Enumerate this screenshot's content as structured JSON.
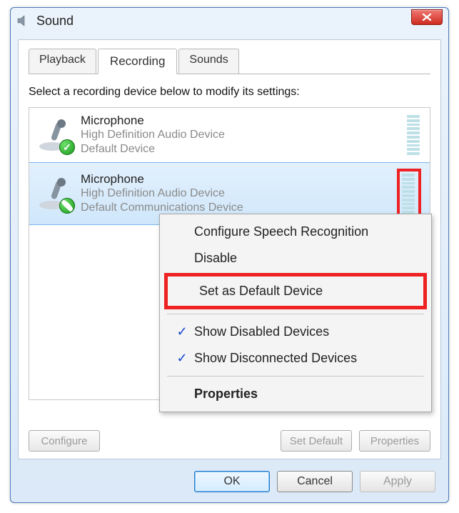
{
  "window": {
    "title": "Sound"
  },
  "tabs": {
    "playback": "Playback",
    "recording": "Recording",
    "sounds": "Sounds",
    "active_index": 1
  },
  "instruction": "Select a recording device below to modify its settings:",
  "devices": [
    {
      "name": "Microphone",
      "controller": "High Definition Audio Device",
      "status": "Default Device",
      "badge": "check",
      "selected": false
    },
    {
      "name": "Microphone",
      "controller": "High Definition Audio Device",
      "status": "Default Communications Device",
      "badge": "phone",
      "selected": true
    }
  ],
  "context_menu": {
    "configure_speech": "Configure Speech Recognition",
    "disable": "Disable",
    "set_default": "Set as Default Device",
    "show_disabled": "Show Disabled Devices",
    "show_disconnected": "Show Disconnected Devices",
    "properties": "Properties",
    "show_disabled_checked": true,
    "show_disconnected_checked": true
  },
  "lower_buttons": {
    "configure": "Configure",
    "set_default": "Set Default",
    "properties": "Properties"
  },
  "dialog_buttons": {
    "ok": "OK",
    "cancel": "Cancel",
    "apply": "Apply"
  },
  "highlight_color": "#e22222"
}
